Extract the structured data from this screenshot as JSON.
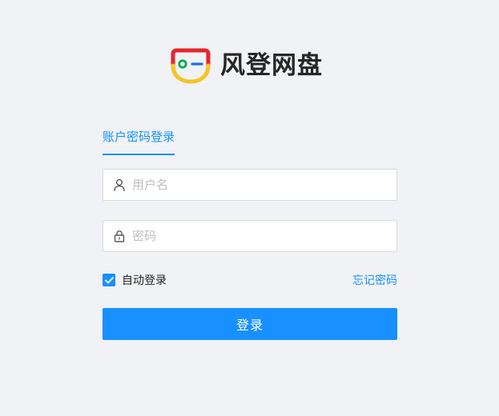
{
  "brand": {
    "name": "风登网盘",
    "logo_icon": "face-logo-icon"
  },
  "tabs": [
    {
      "label": "账户密码登录",
      "active": true
    }
  ],
  "form": {
    "username": {
      "placeholder": "用户名",
      "value": "",
      "icon": "user-icon"
    },
    "password": {
      "placeholder": "密码",
      "value": "",
      "icon": "lock-icon"
    },
    "remember": {
      "label": "自动登录",
      "checked": true
    },
    "forgot_label": "忘记密码",
    "submit_label": "登录"
  },
  "colors": {
    "primary": "#1890ff",
    "background": "#f0f2f5",
    "logo_red": "#e5262c",
    "logo_yellow": "#f6c525",
    "logo_green": "#0aa84f",
    "logo_blue": "#1c6fe0"
  }
}
